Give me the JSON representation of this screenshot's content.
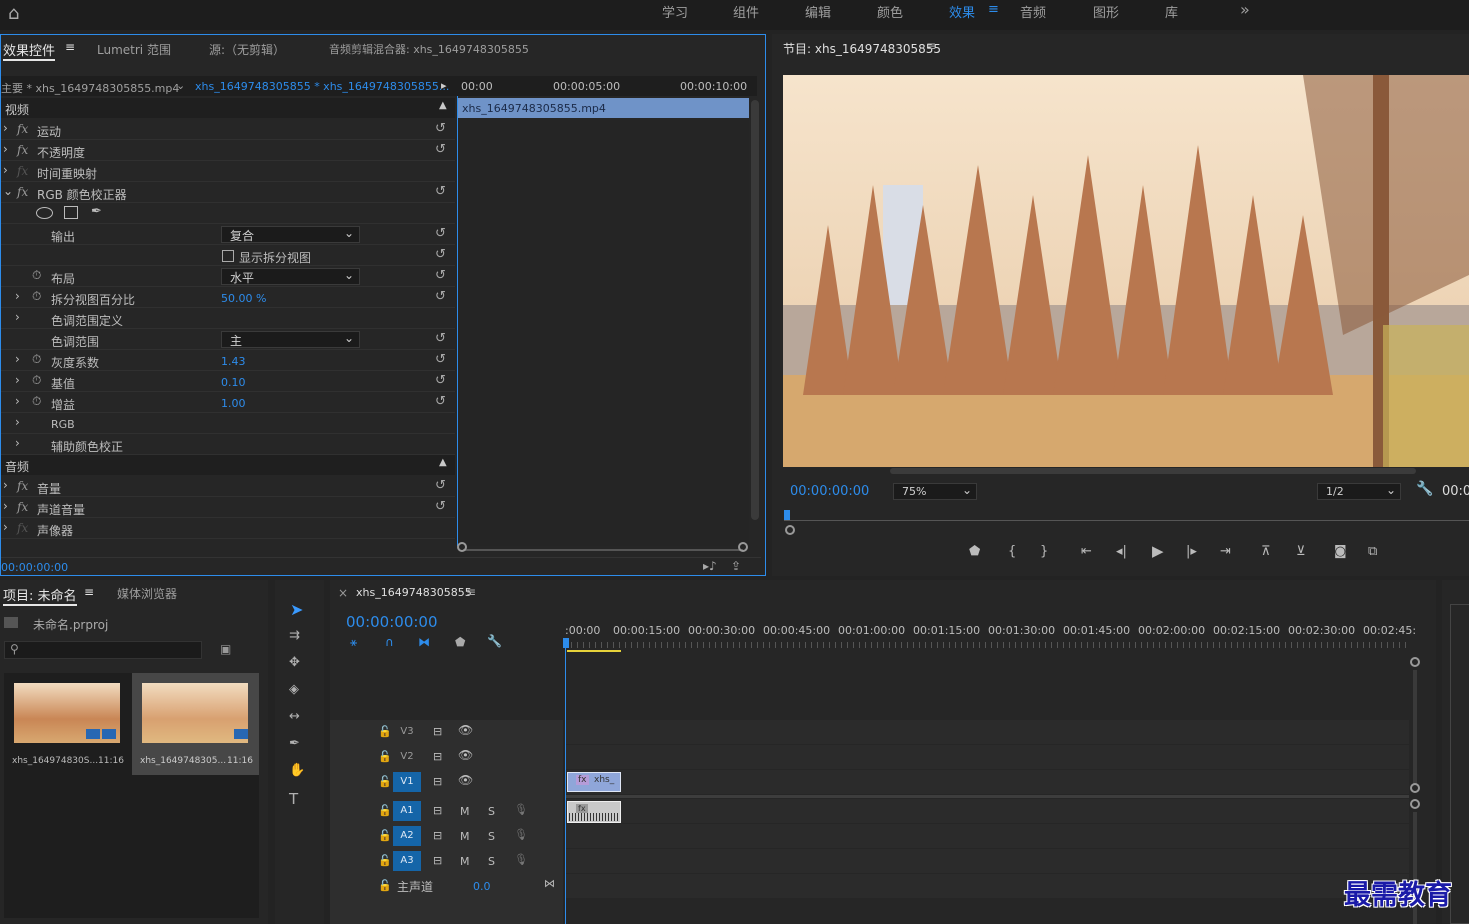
{
  "workspaces": {
    "learn": "学习",
    "assembly": "组件",
    "edit": "编辑",
    "color": "颜色",
    "effects": "效果",
    "audio": "音频",
    "graphics": "图形",
    "library": "库",
    "more": "»"
  },
  "effect_controls": {
    "tabs": {
      "effect_controls": "效果控件",
      "lumetri": "Lumetri 范围",
      "source": "源:（无剪辑）",
      "audio_mixer": "音频剪辑混合器: xhs_1649748305855"
    },
    "master_clip": "主要 * xhs_1649748305855.mp4",
    "seq_clip": "xhs_1649748305855 * xhs_1649748305855...",
    "ruler": {
      "t0": "00:00",
      "t1": "00:00:05:00",
      "t2": "00:00:10:00"
    },
    "clip_label": "xhs_1649748305855.mp4",
    "video_section": "视频",
    "audio_section": "音频",
    "motion": "运动",
    "opacity": "不透明度",
    "time_remap": "时间重映射",
    "rgb_corrector": "RGB 颜色校正器",
    "output_label": "输出",
    "output_value": "复合",
    "split_view_label": "显示拆分视图",
    "layout_label": "布局",
    "layout_value": "水平",
    "split_percent_label": "拆分视图百分比",
    "split_percent_value": "50.00 %",
    "tonal_def": "色调范围定义",
    "tonal_label": "色调范围",
    "tonal_value": "主",
    "gamma_label": "灰度系数",
    "gamma_value": "1.43",
    "pedestal_label": "基值",
    "pedestal_value": "0.10",
    "gain_label": "增益",
    "gain_value": "1.00",
    "rgb": "RGB",
    "secondary": "辅助颜色校正",
    "volume": "音量",
    "channel_volume": "声道音量",
    "panner": "声像器",
    "timecode": "00:00:00:00"
  },
  "program": {
    "title": "节目: xhs_1649748305855",
    "timecode": "00:00:00:00",
    "zoom": "75%",
    "quality": "1/2",
    "end_tc": "00:0"
  },
  "project": {
    "tab_project": "项目: 未命名",
    "tab_media": "媒体浏览器",
    "file": "未命名.prproj",
    "items": [
      {
        "name": "xhs_164974830S...",
        "dur": "11:16"
      },
      {
        "name": "xhs_1649748305...",
        "dur": "11:16"
      }
    ]
  },
  "timeline": {
    "seq_tab": "xhs_1649748305855",
    "timecode": "00:00:00:00",
    "ticks": [
      ":00:00",
      "00:00:15:00",
      "00:00:30:00",
      "00:00:45:00",
      "00:01:00:00",
      "00:01:15:00",
      "00:01:30:00",
      "00:01:45:00",
      "00:02:00:00",
      "00:02:15:00",
      "00:02:30:00",
      "00:02:45:"
    ],
    "tracks": {
      "v3": "V3",
      "v2": "V2",
      "v1": "V1",
      "a1": "A1",
      "a2": "A2",
      "a3": "A3",
      "m": "M",
      "s": "S"
    },
    "master": "主声道",
    "master_val": "0.0",
    "clip_v": "xhs_",
    "fx": "fx"
  },
  "watermark": "最需教育",
  "colors": {
    "accent": "#2d8ceb",
    "clip_video": "#8fa6d9",
    "clip_audio": "#c9c9c9"
  }
}
